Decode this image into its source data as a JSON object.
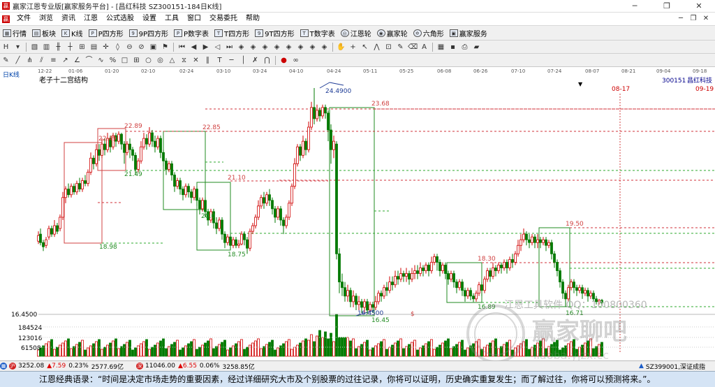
{
  "window": {
    "title": "赢家江恩专业版[赢家服务平台] - [昌红科技  SZ300151-184日K线]",
    "app_icon": "赢",
    "controls": [
      "─",
      "❐",
      "✕"
    ]
  },
  "menu": {
    "items": [
      "文件",
      "浏览",
      "资讯",
      "江恩",
      "公式选股",
      "设置",
      "工具",
      "窗口",
      "交易委托",
      "帮助"
    ],
    "mdi_controls": [
      "─",
      "❐",
      "✕"
    ]
  },
  "toolbar1": {
    "items": [
      {
        "icon": "hq",
        "label": "行情"
      },
      {
        "icon": "bk",
        "label": "板块"
      },
      {
        "icon": "K",
        "label": "K线"
      },
      {
        "icon": "P",
        "label": "P四方形"
      },
      {
        "icon": "9P",
        "label": "9P四方形"
      },
      {
        "icon": "PN",
        "label": "P数字表"
      },
      {
        "icon": "T",
        "label": "T四方形"
      },
      {
        "icon": "9T",
        "label": "9T四方形"
      },
      {
        "icon": "TN",
        "label": "T数字表"
      },
      {
        "icon": "jel",
        "label": "江恩轮"
      },
      {
        "icon": "yjl",
        "label": "赢家轮"
      },
      {
        "icon": "ljx",
        "label": "六角形"
      },
      {
        "icon": "yjfw",
        "label": "赢家服务"
      }
    ]
  },
  "chart": {
    "period": "日K线",
    "indicator": "老子十二宫结构",
    "stock_code": "300151",
    "stock_name": "昌红科技",
    "date_axis": [
      "12-22",
      "01-06",
      "01-20",
      "02-10",
      "02-24",
      "03-10",
      "03-24",
      "04-10",
      "04-24",
      "05-11",
      "05-25",
      "06-08",
      "06-26",
      "07-10",
      "07-24",
      "08-07",
      "08-21",
      "09-04",
      "09-18"
    ],
    "marker_dates": [
      "08-17",
      "09-19"
    ],
    "price_axis_label": "16.4500",
    "volume_axis": [
      "184524",
      "123016",
      "61508"
    ],
    "price_labels": [
      "22.89",
      "22.49",
      "22.85",
      "21.49",
      "21.10",
      "18.98",
      "20.0",
      "18.75",
      "24.4900",
      "23.68",
      "16.4500",
      "16.45",
      "18.30",
      "16.89",
      "19.50",
      "16.71"
    ],
    "dollar_mark": "$",
    "watermark_contact": "江恩工具软件 QQ：100800360",
    "watermark_brand": "赢家聊吧",
    "watermark_url": "liaoba.yjzx.cc"
  },
  "status": {
    "index1_value": "3252.08",
    "index1_change": "▲7.59",
    "index1_pct": "0.23%",
    "index1_amount": "2577.69亿",
    "index2_value": "11046.00",
    "index2_change": "▲6.55",
    "index2_pct": "0.06%",
    "index2_amount": "3258.85亿",
    "right_label": "SZ399001,深证成指"
  },
  "quote_bar": "江恩经典语录：“时间是决定市场走势的重要因素，经过详细研究大市及个别股票的过往记录，你将可以证明，历史确实重复发生；而了解过往，你将可以预测将来。”。",
  "colors": {
    "up": "#d00000",
    "down": "#007a00",
    "box_red": "#d04040",
    "box_green": "#228b22",
    "dash_red": "#d0303a",
    "dash_green": "#2ea82e"
  }
}
